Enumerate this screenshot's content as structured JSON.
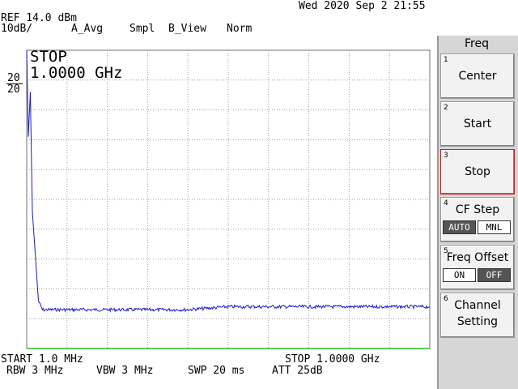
{
  "header": {
    "datetime": "Wed 2020 Sep  2 21:55",
    "ref": "REF 14.0 dBm",
    "scale": "10dB/",
    "avg": "A_Avg",
    "smpl": "Smpl",
    "view": "B_View",
    "mode": "Norm"
  },
  "side_scale": {
    "upper": "20",
    "lower": "20"
  },
  "marker": {
    "title": "STOP",
    "value": "1.0000 GHz"
  },
  "footer": {
    "start": "START 1.0 MHz",
    "stop": "STOP 1.0000 GHz",
    "rbw": "RBW 3 MHz",
    "vbw": "VBW 3 MHz",
    "swp": "SWP 20 ms",
    "att": "ATT 25dB"
  },
  "menu": {
    "title": "Freq",
    "keys": [
      {
        "num": "1",
        "label": "Center"
      },
      {
        "num": "2",
        "label": "Start"
      },
      {
        "num": "3",
        "label": "Stop"
      },
      {
        "num": "4",
        "label": "CF Step",
        "toggle": [
          "AUTO",
          "MNL"
        ],
        "active": "AUTO"
      },
      {
        "num": "5",
        "label": "Freq Offset",
        "toggle": [
          "ON",
          "OFF"
        ],
        "active": "OFF"
      },
      {
        "num": "6",
        "label": "Channel",
        "label2": "Setting"
      }
    ],
    "selected": "Stop"
  },
  "colors": {
    "trace": "#1c1cc8",
    "grid": "#a0a0a0",
    "frame_bottom": "#20c020",
    "selected_border": "#c02020"
  },
  "chart_data": {
    "type": "line",
    "title": "",
    "xlabel": "",
    "ylabel": "",
    "x_range_hz": [
      1000000,
      1000000000
    ],
    "y_ref_dbm": 14.0,
    "y_scale_db_per_div": 10,
    "y_divisions": 10,
    "x_divisions": 10,
    "grid": true,
    "series": [
      {
        "x_mhz": [
          1,
          5,
          10,
          15,
          20,
          25,
          30,
          40,
          60,
          100,
          200,
          300,
          400,
          500,
          600,
          700,
          800,
          900,
          1000
        ],
        "y_dbm": [
          14,
          -15,
          0,
          -40,
          -50,
          -60,
          -70,
          -73,
          -73,
          -73,
          -73,
          -73,
          -73,
          -72,
          -72,
          -72,
          -72,
          -72,
          -72
        ]
      }
    ]
  }
}
